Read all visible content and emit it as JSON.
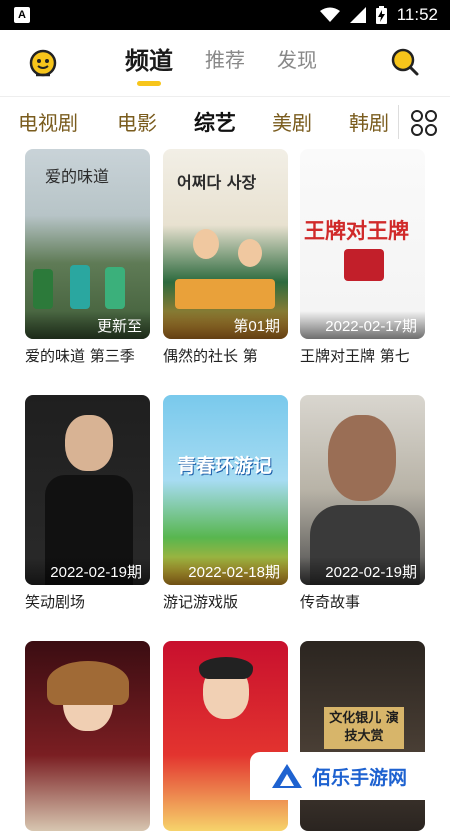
{
  "status_bar": {
    "app_badge": "A",
    "time": "11:52",
    "icons": [
      "wifi-icon",
      "signal-icon",
      "battery-charging-icon"
    ]
  },
  "header": {
    "logo_icon": "mascot-logo-icon",
    "tabs": [
      {
        "label": "频道",
        "active": true
      },
      {
        "label": "推荐",
        "active": false
      },
      {
        "label": "发现",
        "active": false
      }
    ],
    "search_icon": "search-icon",
    "accent": "#f7c51b"
  },
  "categories": {
    "items": [
      {
        "label": "电视剧",
        "active": false
      },
      {
        "label": "电影",
        "active": false
      },
      {
        "label": "综艺",
        "active": true
      },
      {
        "label": "美剧",
        "active": false
      },
      {
        "label": "韩剧",
        "active": false
      }
    ],
    "more_icon": "grid-icon"
  },
  "cards": [
    {
      "title": "爱的味道 第三季",
      "badge": "更新至",
      "poster_text": "爱的味道"
    },
    {
      "title": "偶然的社长 第",
      "badge": "第01期",
      "poster_text": "어쩌다 사장"
    },
    {
      "title": "王牌对王牌 第七",
      "badge": "2022-02-17期",
      "poster_text": "王牌对王牌"
    },
    {
      "title": "笑动剧场",
      "badge": "2022-02-19期",
      "poster_text": ""
    },
    {
      "title": "游记游戏版",
      "badge": "2022-02-18期",
      "poster_text": "青春环游记"
    },
    {
      "title": "传奇故事",
      "badge": "2022-02-19期",
      "poster_text": ""
    },
    {
      "title": "",
      "badge": "",
      "poster_text": ""
    },
    {
      "title": "",
      "badge": "",
      "poster_text": ""
    },
    {
      "title": "",
      "badge": "",
      "poster_text": "文化银儿 演技大赏"
    }
  ],
  "watermark": {
    "text": "佰乐手游网"
  }
}
